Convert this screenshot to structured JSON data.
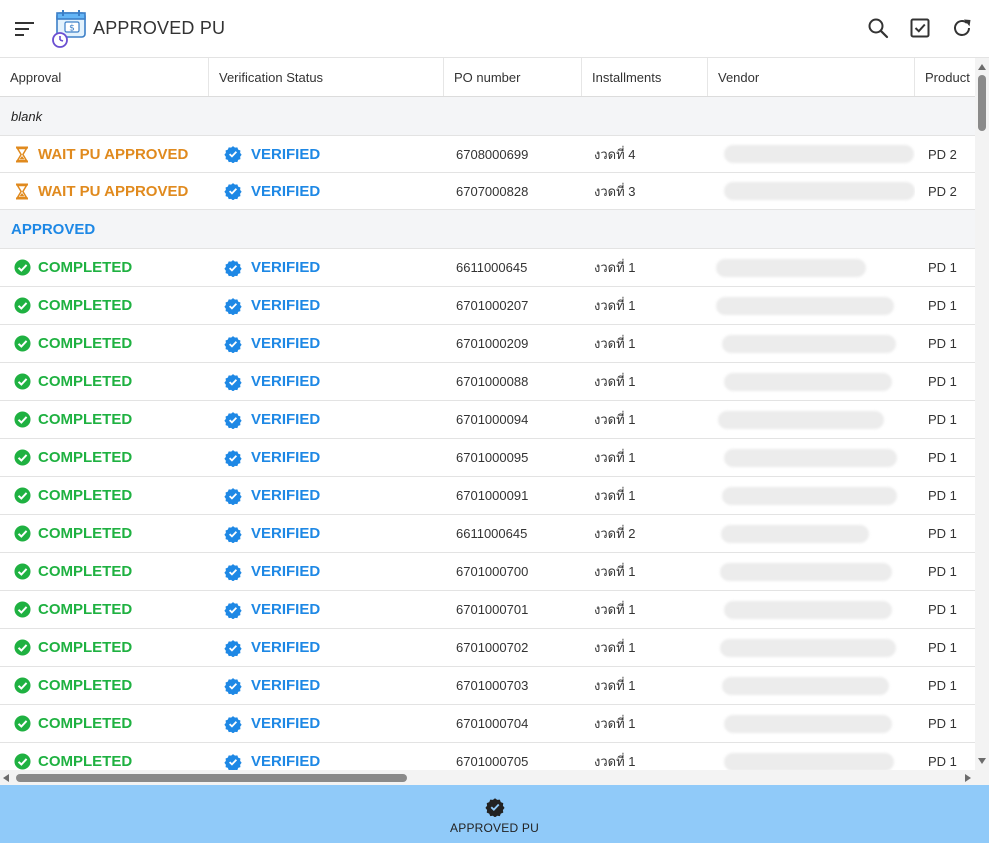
{
  "header": {
    "title": "APPROVED PU",
    "menu_icon": "sort-menu-icon",
    "logo_icon": "money-calendar-icon",
    "actions": [
      "search-icon",
      "checkbox-icon",
      "refresh-icon"
    ]
  },
  "table": {
    "columns": [
      "Approval",
      "Verification Status",
      "PO number",
      "Installments",
      "Vendor",
      "Product"
    ],
    "groups": [
      {
        "label": "blank",
        "rows": [
          {
            "approval": "WAIT PU APPROVED",
            "approval_type": "waiting",
            "verification": "VERIFIED",
            "po": "6708000699",
            "installment": "งวดที่ 4",
            "product": "PD 2"
          },
          {
            "approval": "WAIT PU APPROVED",
            "approval_type": "waiting",
            "verification": "VERIFIED",
            "po": "6707000828",
            "installment": "งวดที่ 3",
            "product": "PD 2"
          }
        ]
      },
      {
        "label": "APPROVED",
        "rows": [
          {
            "approval": "COMPLETED",
            "approval_type": "completed",
            "verification": "VERIFIED",
            "po": "6611000645",
            "installment": "งวดที่ 1",
            "product": "PD 1"
          },
          {
            "approval": "COMPLETED",
            "approval_type": "completed",
            "verification": "VERIFIED",
            "po": "6701000207",
            "installment": "งวดที่ 1",
            "product": "PD 1"
          },
          {
            "approval": "COMPLETED",
            "approval_type": "completed",
            "verification": "VERIFIED",
            "po": "6701000209",
            "installment": "งวดที่ 1",
            "product": "PD 1"
          },
          {
            "approval": "COMPLETED",
            "approval_type": "completed",
            "verification": "VERIFIED",
            "po": "6701000088",
            "installment": "งวดที่ 1",
            "product": "PD 1"
          },
          {
            "approval": "COMPLETED",
            "approval_type": "completed",
            "verification": "VERIFIED",
            "po": "6701000094",
            "installment": "งวดที่ 1",
            "product": "PD 1"
          },
          {
            "approval": "COMPLETED",
            "approval_type": "completed",
            "verification": "VERIFIED",
            "po": "6701000095",
            "installment": "งวดที่ 1",
            "product": "PD 1"
          },
          {
            "approval": "COMPLETED",
            "approval_type": "completed",
            "verification": "VERIFIED",
            "po": "6701000091",
            "installment": "งวดที่ 1",
            "product": "PD 1"
          },
          {
            "approval": "COMPLETED",
            "approval_type": "completed",
            "verification": "VERIFIED",
            "po": "6611000645",
            "installment": "งวดที่ 2",
            "product": "PD 1"
          },
          {
            "approval": "COMPLETED",
            "approval_type": "completed",
            "verification": "VERIFIED",
            "po": "6701000700",
            "installment": "งวดที่ 1",
            "product": "PD 1"
          },
          {
            "approval": "COMPLETED",
            "approval_type": "completed",
            "verification": "VERIFIED",
            "po": "6701000701",
            "installment": "งวดที่ 1",
            "product": "PD 1"
          },
          {
            "approval": "COMPLETED",
            "approval_type": "completed",
            "verification": "VERIFIED",
            "po": "6701000702",
            "installment": "งวดที่ 1",
            "product": "PD 1"
          },
          {
            "approval": "COMPLETED",
            "approval_type": "completed",
            "verification": "VERIFIED",
            "po": "6701000703",
            "installment": "งวดที่ 1",
            "product": "PD 1"
          },
          {
            "approval": "COMPLETED",
            "approval_type": "completed",
            "verification": "VERIFIED",
            "po": "6701000704",
            "installment": "งวดที่ 1",
            "product": "PD 1"
          },
          {
            "approval": "COMPLETED",
            "approval_type": "completed",
            "verification": "VERIFIED",
            "po": "6701000705",
            "installment": "งวดที่ 1",
            "product": "PD 1"
          }
        ]
      }
    ]
  },
  "bottom_nav": {
    "label": "APPROVED PU",
    "icon": "verified-badge-icon"
  },
  "colors": {
    "completed": "#1fb141",
    "waiting": "#e08a1e",
    "verified": "#1e88e5",
    "bottom_nav_bg": "#90caf9",
    "group_bg": "#f4f5f7"
  }
}
